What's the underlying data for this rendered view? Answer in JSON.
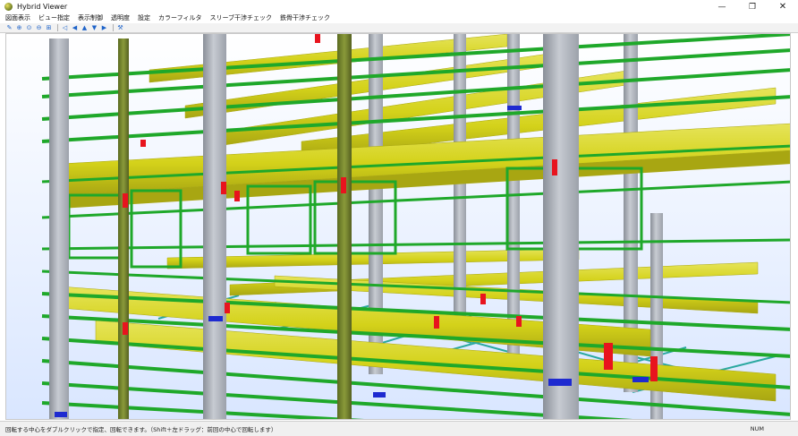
{
  "window": {
    "title": "Hybrid Viewer",
    "minimize_glyph": "—",
    "maximize_glyph": "❐",
    "close_glyph": "✕"
  },
  "menu": {
    "items": [
      {
        "label": "図面表示"
      },
      {
        "label": "ビュー指定"
      },
      {
        "label": "表示制御"
      },
      {
        "label": "透明度"
      },
      {
        "label": "設定"
      },
      {
        "label": "カラーフィルタ"
      },
      {
        "label": "スリーブ干渉チェック"
      },
      {
        "label": "鉄骨干渉チェック"
      }
    ]
  },
  "toolbar": {
    "buttons": [
      {
        "icon": "pencil-icon",
        "glyph": "✎"
      },
      {
        "icon": "zoom-in-icon",
        "glyph": "⊕"
      },
      {
        "icon": "zoom-fit-icon",
        "glyph": "⊙"
      },
      {
        "icon": "zoom-out-icon",
        "glyph": "⊖"
      },
      {
        "icon": "zoom-box-icon",
        "glyph": "⊞"
      },
      {
        "icon": "back-icon",
        "glyph": "◁"
      },
      {
        "icon": "arrow-left-icon",
        "glyph": "◀"
      },
      {
        "icon": "arrow-up-icon",
        "glyph": "▲"
      },
      {
        "icon": "arrow-down-icon",
        "glyph": "▼"
      },
      {
        "icon": "arrow-right-icon",
        "glyph": "▶"
      },
      {
        "icon": "tool-icon",
        "glyph": "⚒"
      }
    ]
  },
  "status": {
    "message": "回転する中心をダブルクリックで指定、回転できます。（Shift＋左ドラッグ：前回の中心で回転します）",
    "mode": "NUM"
  },
  "colors": {
    "beam_yellow": "#d4d21a",
    "beam_yellow_dark": "#a8a612",
    "beam_yellow_light": "#e6e45a",
    "column_gray": "#a9aeb6",
    "column_gray_dark": "#8a8f98",
    "column_gray_light": "#c7cbd2",
    "purlin_green": "#1fa82a",
    "purlin_green_dark": "#137a1b",
    "brace_teal": "#2aa8a0",
    "joint_red": "#e8141e",
    "base_blue": "#1e2ad0",
    "sky_top": "#ffffff",
    "sky_bottom": "#d9e6ff"
  }
}
